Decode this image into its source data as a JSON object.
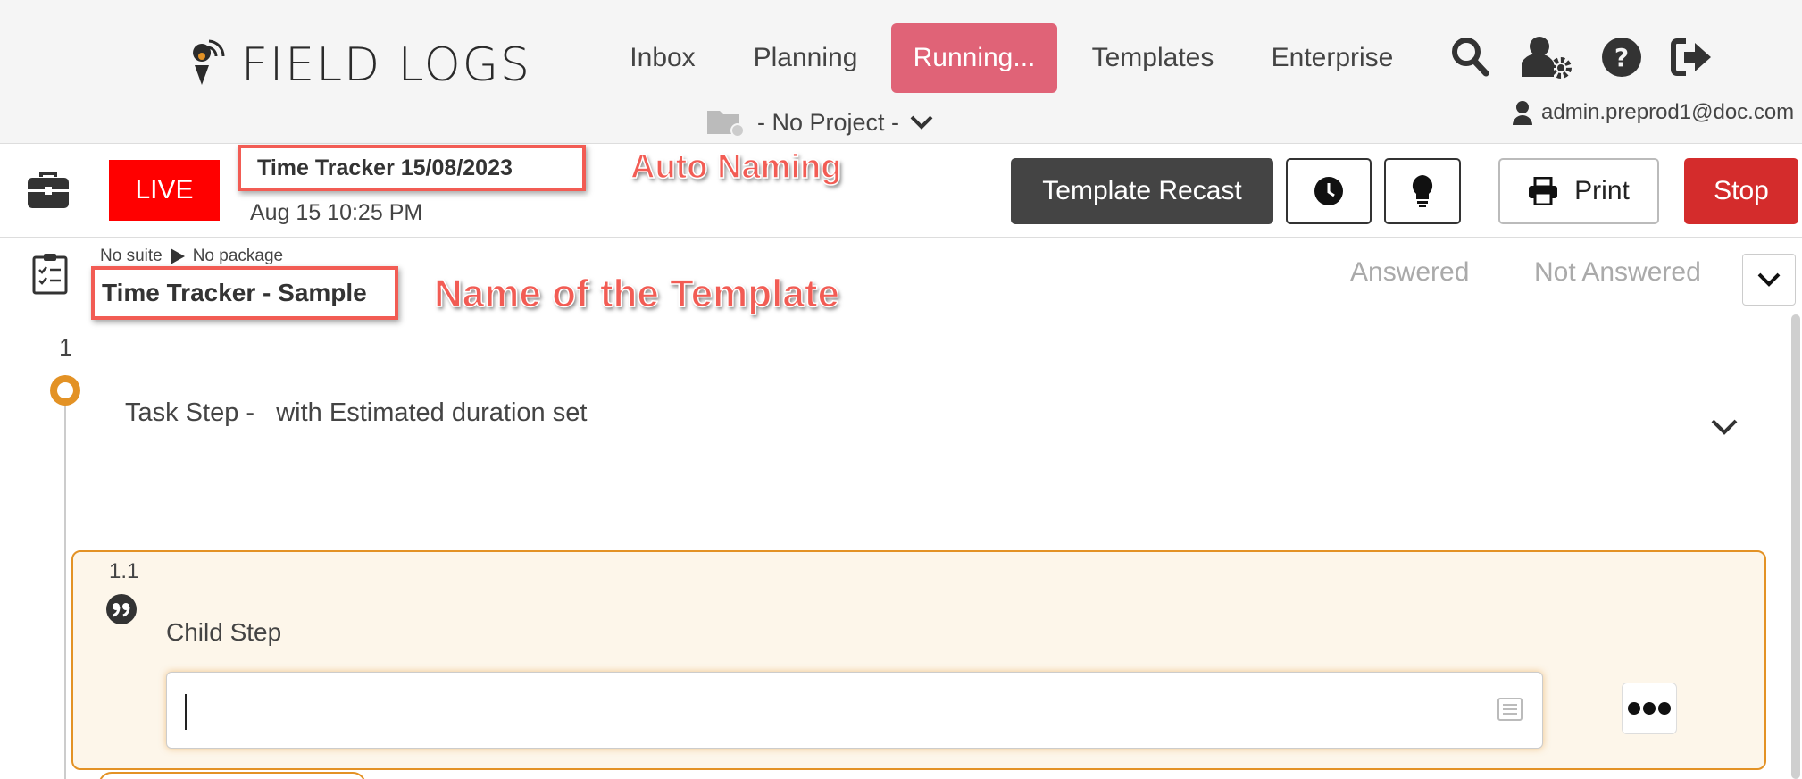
{
  "app": {
    "brand": "FIELD LOGS",
    "accent_color": "#e06377",
    "live_color": "#ff0000",
    "stop_color": "#d42c2c",
    "step_color": "#e39225"
  },
  "nav": {
    "items": [
      {
        "label": "Inbox",
        "active": false
      },
      {
        "label": "Planning",
        "active": false
      },
      {
        "label": "Running...",
        "active": true
      },
      {
        "label": "Templates",
        "active": false
      },
      {
        "label": "Enterprise",
        "active": false
      }
    ],
    "icons": [
      "search-icon",
      "user-settings-icon",
      "help-icon",
      "logout-icon"
    ],
    "project_selector": "- No Project -",
    "user_email": "admin.preprod1@doc.com"
  },
  "run": {
    "status": "LIVE",
    "name": "Time Tracker 15/08/2023",
    "datetime": "Aug 15 10:25 PM",
    "buttons": {
      "recast": "Template Recast",
      "history_icon": "clock-icon",
      "tips_icon": "lightbulb-icon",
      "print": "Print",
      "stop": "Stop"
    }
  },
  "annotations": {
    "auto_naming": "Auto Naming",
    "template_name": "Name of the Template"
  },
  "template": {
    "suite": "No suite",
    "package": "No package",
    "name": "Time Tracker - Sample",
    "filters": {
      "answered": "Answered",
      "not_answered": "Not Answered"
    }
  },
  "steps": [
    {
      "number": "1",
      "label": "Task Step -   with Estimated duration set",
      "children": [
        {
          "number": "1.1",
          "label": "Child Step",
          "input_value": "",
          "icon": "quote-icon"
        }
      ]
    }
  ]
}
